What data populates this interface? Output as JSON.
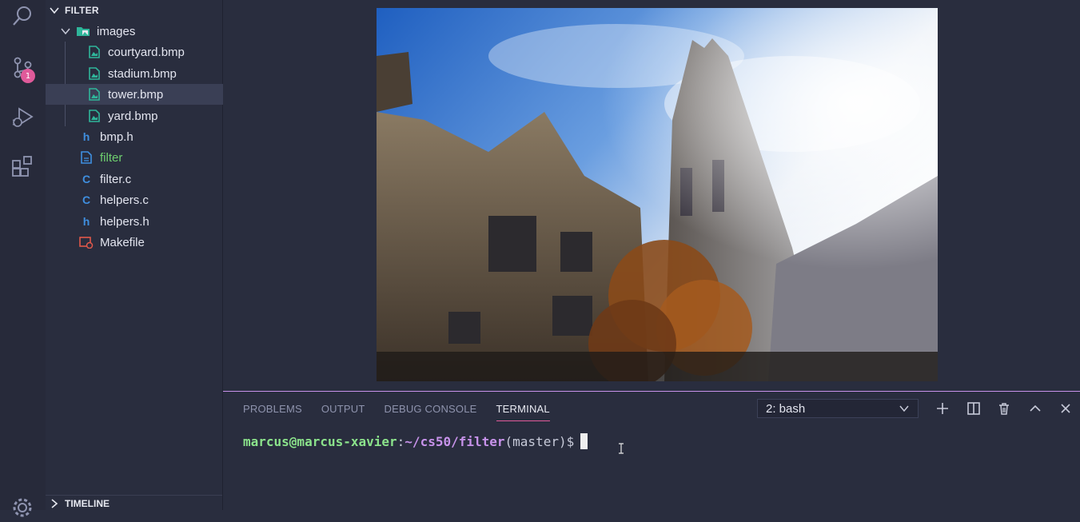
{
  "sidebar": {
    "header": "FILTER",
    "items": [
      {
        "label": "images",
        "icon": "folder-images-icon",
        "kind": "folder"
      },
      {
        "label": "courtyard.bmp",
        "icon": "image-file-icon"
      },
      {
        "label": "stadium.bmp",
        "icon": "image-file-icon"
      },
      {
        "label": "tower.bmp",
        "icon": "image-file-icon",
        "selected": true
      },
      {
        "label": "yard.bmp",
        "icon": "image-file-icon"
      },
      {
        "label": "bmp.h",
        "icon": "h-file-icon",
        "glyph": "h"
      },
      {
        "label": "filter",
        "icon": "file-icon",
        "git_status": "U"
      },
      {
        "label": "filter.c",
        "icon": "c-file-icon",
        "glyph": "C"
      },
      {
        "label": "helpers.c",
        "icon": "c-file-icon",
        "glyph": "C"
      },
      {
        "label": "helpers.h",
        "icon": "h-file-icon",
        "glyph": "h"
      },
      {
        "label": "Makefile",
        "icon": "makefile-icon"
      }
    ],
    "timeline_label": "TIMELINE"
  },
  "activity": {
    "source_control_badge": "1"
  },
  "panel": {
    "tabs": [
      "PROBLEMS",
      "OUTPUT",
      "DEBUG CONSOLE",
      "TERMINAL"
    ],
    "active_tab": "TERMINAL",
    "terminal_select": "2: bash"
  },
  "terminal": {
    "user": "marcus@marcus-xavier",
    "sep": ":",
    "path": "~/cs50/filter",
    "branch": "(master)",
    "prompt": "$"
  },
  "colors": {
    "accent": "#c792ea",
    "badge": "#e05a9a",
    "git_untracked": "#6fd06f",
    "image_icon": "#2fb59a",
    "c_h_icon": "#3f8fe0",
    "makefile_icon": "#e0584a"
  }
}
